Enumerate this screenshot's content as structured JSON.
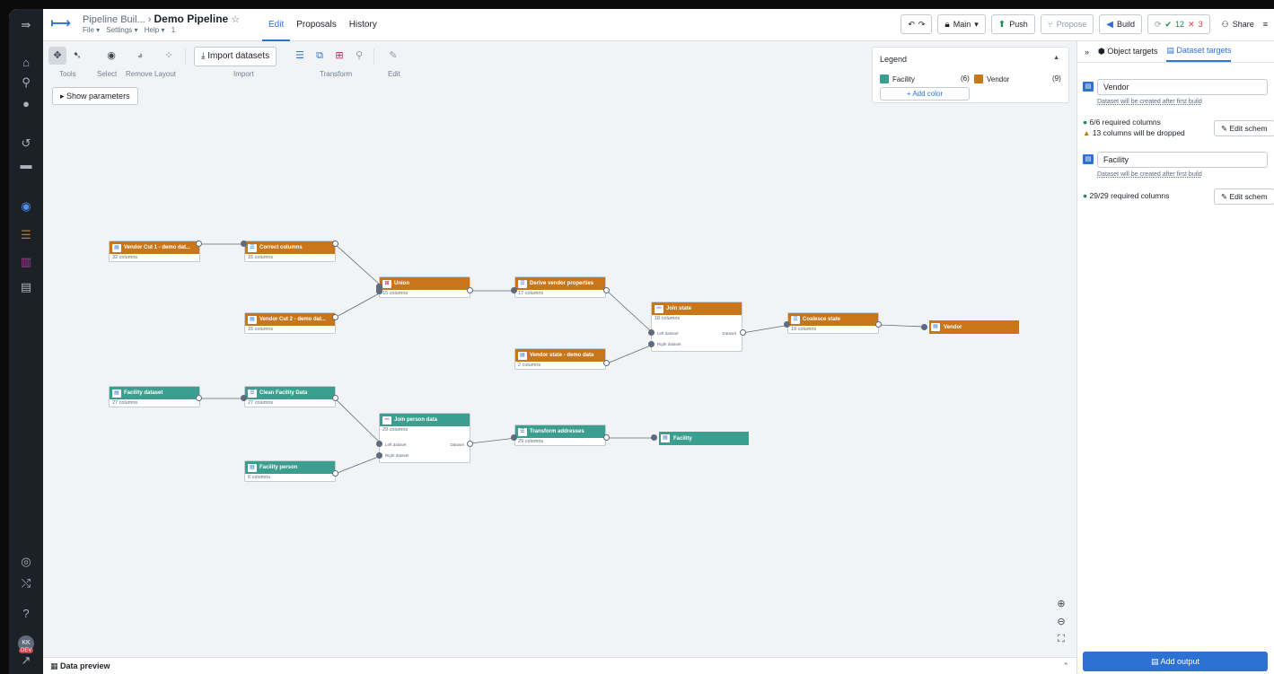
{
  "header": {
    "app_name": "Pipeline Buil...",
    "pipeline_name": "Demo Pipeline",
    "menus": [
      "File ▾",
      "Settings ▾",
      "Help ▾",
      "1"
    ],
    "tabs": [
      "Edit",
      "Proposals",
      "History"
    ],
    "branch": "Main",
    "push": "Push",
    "propose": "Propose",
    "build": "Build",
    "checks_pass": "12",
    "checks_fail": "3",
    "share": "Share"
  },
  "toolbar": {
    "groups": [
      "Tools",
      "Select",
      "Remove",
      "Layout",
      "Import",
      "Transform",
      "Edit"
    ],
    "import_button": "Import datasets",
    "show_parameters": "Show parameters"
  },
  "legend": {
    "title": "Legend",
    "items": [
      {
        "name": "Facility",
        "count": "(6)",
        "color": "#3b9e8f"
      },
      {
        "name": "Vendor",
        "count": "(9)",
        "color": "#c87619"
      }
    ],
    "add_color": "Add color"
  },
  "nodes": {
    "vendor_cut1": {
      "title": "Vendor Cut 1 - demo dat...",
      "sub": "32 columns"
    },
    "correct_columns": {
      "title": "Correct columns",
      "sub": "15 columns"
    },
    "vendor_cut2": {
      "title": "Vendor Cut 2 - demo dat...",
      "sub": "15 columns"
    },
    "union": {
      "title": "Union",
      "sub": "15 columns"
    },
    "derive_vendor": {
      "title": "Derive vendor properties",
      "sub": "17 columns"
    },
    "vendor_state": {
      "title": "Vendor state - demo data",
      "sub": "2 columns"
    },
    "join_state": {
      "title": "Join state",
      "sub": "18 columns",
      "left": "Left dataset",
      "right": "Right dataset",
      "out": "Dataset"
    },
    "coalesce_state": {
      "title": "Coalesce state",
      "sub": "19 columns"
    },
    "vendor_out": {
      "title": "Vendor"
    },
    "facility_dataset": {
      "title": "Facility dataset",
      "sub": "27 columns"
    },
    "clean_facility": {
      "title": "Clean Facility Data",
      "sub": "27 columns"
    },
    "join_person": {
      "title": "Join person data",
      "sub": "29 columns",
      "left": "Left dataset",
      "right": "Right dataset",
      "out": "Dataset"
    },
    "transform_addresses": {
      "title": "Transform addresses",
      "sub": "29 columns"
    },
    "facility_out": {
      "title": "Facility"
    },
    "facility_person": {
      "title": "Facility person",
      "sub": "6 columns"
    }
  },
  "preview": {
    "label": "Data preview"
  },
  "panel": {
    "tabs": [
      "Object targets",
      "Dataset targets"
    ],
    "targets": [
      {
        "name": "Vendor",
        "note": "Dataset will be created after first build",
        "required": "6/6 required columns",
        "warning": "13 columns will be dropped",
        "edit": "Edit schem"
      },
      {
        "name": "Facility",
        "note": "Dataset will be created after first build",
        "required": "29/29 required columns",
        "warning": "",
        "edit": "Edit schem"
      }
    ],
    "add_output": "Add output"
  }
}
